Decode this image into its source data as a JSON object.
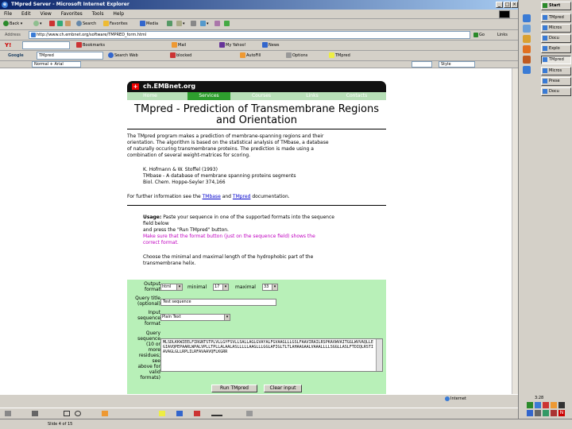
{
  "window": {
    "title": "TMpred Server - Microsoft Internet Explorer",
    "menu": [
      "File",
      "Edit",
      "View",
      "Favorites",
      "Tools",
      "Help"
    ]
  },
  "toolbar": {
    "back": "Back",
    "search": "Search",
    "favorites": "Favorites",
    "media": "Media"
  },
  "address": {
    "label": "Address",
    "url": "http://www.ch.embnet.org/software/TMPRED_form.html",
    "go": "Go",
    "links": "Links"
  },
  "yahoo_bar": {
    "logo": "Y!",
    "search_value": "",
    "bookmarks": "Bookmarks",
    "mail": "Mail",
    "my_yahoo": "My Yahoo!",
    "news": "News"
  },
  "google_bar": {
    "label": "Google",
    "search_value": "TMpred",
    "search_web": "Search Web",
    "blocked": "blocked",
    "autofill": "AutoFill",
    "options": "Options",
    "tmpred": "TMpred"
  },
  "format_bar": {
    "style": "Normal + Arial",
    "font": "",
    "size": "Style"
  },
  "page": {
    "logo": "ch.EMBnet.org",
    "nav": [
      "Home",
      "Services",
      "Courses",
      "Links",
      "Contacts"
    ],
    "title_line1": "TMpred - Prediction of Transmembrane Regions",
    "title_line2": "and Orientation",
    "intro": [
      "The TMpred program makes a prediction of membrane-spanning regions and their",
      "orientation. The algorithm is based on the statistical analysis of TMbase, a database",
      "of naturally occuring transmembrane proteins. The prediction is made using a",
      "combination of several weight-matrices for scoring."
    ],
    "citation": [
      "K. Hofmann & W. Stoffel (1993)",
      "TMbase - A database of membrane spanning proteins segments",
      "Biol. Chem. Hoppe-Seyler 374,166"
    ],
    "doc_prefix": "For further information see the",
    "doc_link1": "TMbase",
    "doc_mid": "and",
    "doc_link2": "TMpred",
    "doc_suffix": "documentation.",
    "usage_label": "Usage:",
    "usage_rest": "Paste your sequence in one of the supported formats into the sequence",
    "usage_line2": "field below",
    "usage_line3": "and press the \"Run TMpred\" button.",
    "warn_line1": "Make sure that the format button (just on the sequence field) shows the",
    "warn_line2": "correct format.",
    "choose_line1": "Choose the minimal and maximal length of the hydrophobic part of the",
    "choose_line2": "transmembrane helix."
  },
  "form": {
    "output_format_label": [
      "Output",
      "format"
    ],
    "output_format_value": "html",
    "minimal_label": "minimal",
    "minimal_value": "17",
    "maximal_label": "maximal",
    "maximal_value": "33",
    "query_title_label": [
      "Query title",
      "(optional)"
    ],
    "query_title_value": "Test sequence",
    "input_format_label": [
      "Input",
      "sequence",
      "format"
    ],
    "input_format_value": "Plain Text",
    "sequence_label": [
      "Query",
      "sequence",
      "(10 or",
      "more",
      "residues;",
      "see",
      "above for",
      "valid",
      "formats)"
    ],
    "sequence_value": "MLSDLKKWIEELFIRGNTSTPLVLLGYFSVLLSALLAGLGVAYALFGVAAGLLLGSLFAAVIRAILRSPKAVWVAITGGLWVVAQLLEGIAVQPEPAARLWPALVPLLTPLLALAALASLLLLLAAGLLLGGLAFIGLTLTLAHAAGAALVAAALLLLSGGLLASLFTDIQLRSTIAVAGLGLLRPLILRFAVAAVQFLKGRR",
    "run_button": "Run TMpred",
    "clear_button": "Clear input"
  },
  "status": {
    "zone": "Internet",
    "page_info": "Slide 4 of 15"
  },
  "taskbar": {
    "start": "Start",
    "clock": "3:28",
    "buttons": [
      "TMpred",
      "Micros",
      "Docu",
      "Explo",
      "TMpred",
      "Micros",
      "Prese",
      "Docu"
    ]
  },
  "colors": {
    "form_bg": "#b8f0b8",
    "nav_bg": "#b7dfb7",
    "nav_active": "#2e9e2e",
    "link": "#0000cc",
    "warning": "#c000c0"
  }
}
